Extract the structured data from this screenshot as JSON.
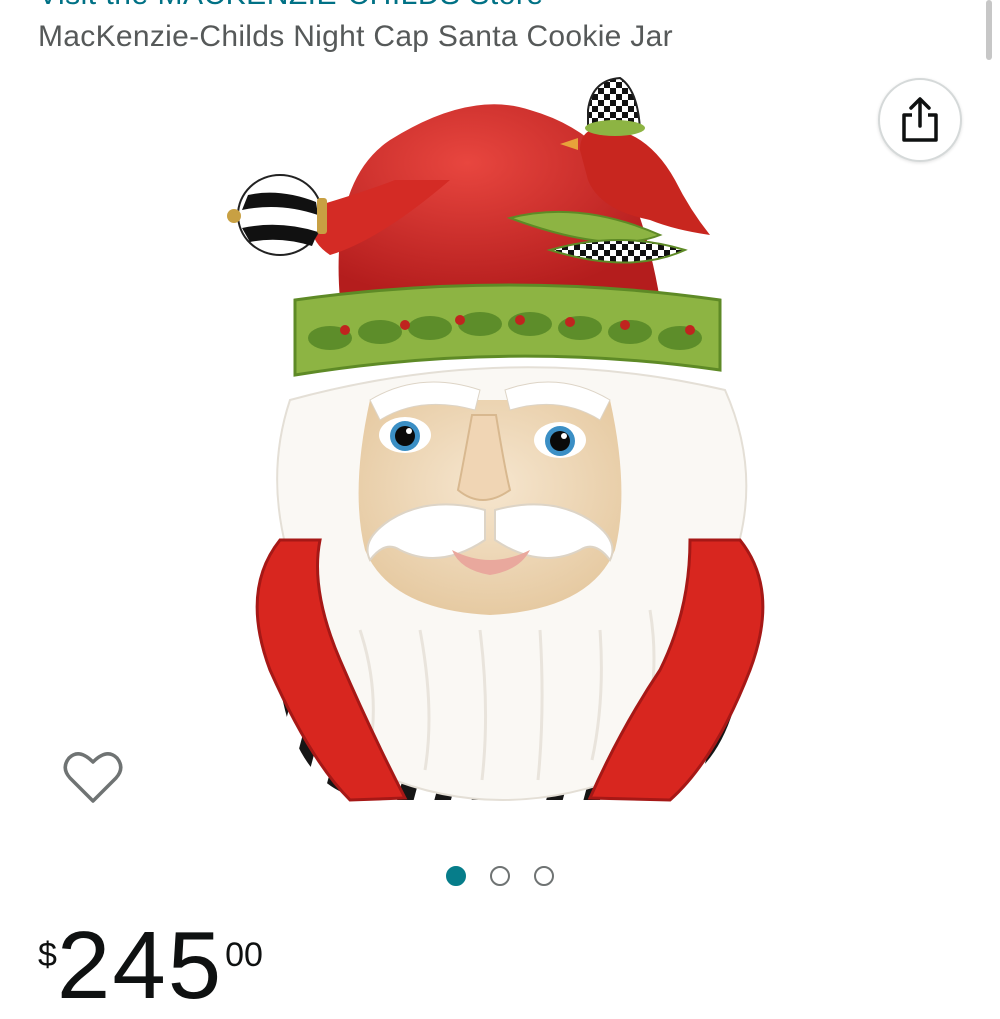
{
  "header": {
    "store_link": "Visit the MACKENZIE-CHILDS Store",
    "product_title": "MacKenzie-Childs Night Cap Santa Cookie Jar"
  },
  "actions": {
    "share_icon": "share-icon",
    "wishlist_icon": "heart-outline-icon"
  },
  "gallery": {
    "image_alt": "Santa cookie jar with red hat, holly band and cardinal",
    "dots": [
      {
        "active": true
      },
      {
        "active": false
      },
      {
        "active": false
      }
    ]
  },
  "price": {
    "symbol": "$",
    "whole": "245",
    "fraction": "00"
  },
  "colors": {
    "link": "#007185",
    "active_dot": "#067d8a",
    "title_text": "#565959"
  }
}
